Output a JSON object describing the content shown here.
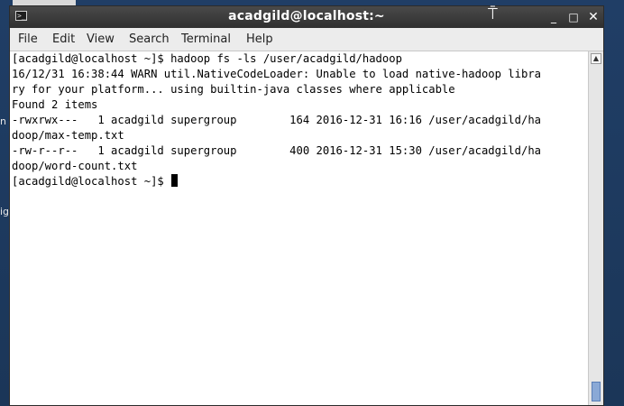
{
  "desktop": {
    "fragment_1": "n",
    "fragment_2": "ig"
  },
  "window": {
    "title": "acadgild@localhost:~",
    "icon": "terminal-icon",
    "buttons": {
      "minimize": "_",
      "maximize": "□",
      "close": "✕"
    }
  },
  "menu": {
    "items": [
      "File",
      "Edit",
      "View",
      "Search",
      "Terminal",
      "Help"
    ]
  },
  "terminal": {
    "lines": [
      "[acadgild@localhost ~]$ hadoop fs -ls /user/acadgild/hadoop",
      "16/12/31 16:38:44 WARN util.NativeCodeLoader: Unable to load native-hadoop libra",
      "ry for your platform... using builtin-java classes where applicable",
      "Found 2 items",
      "-rwxrwx---   1 acadgild supergroup        164 2016-12-31 16:16 /user/acadgild/ha",
      "doop/max-temp.txt",
      "-rw-r--r--   1 acadgild supergroup        400 2016-12-31 15:30 /user/acadgild/ha",
      "doop/word-count.txt",
      "[acadgild@localhost ~]$ "
    ]
  }
}
